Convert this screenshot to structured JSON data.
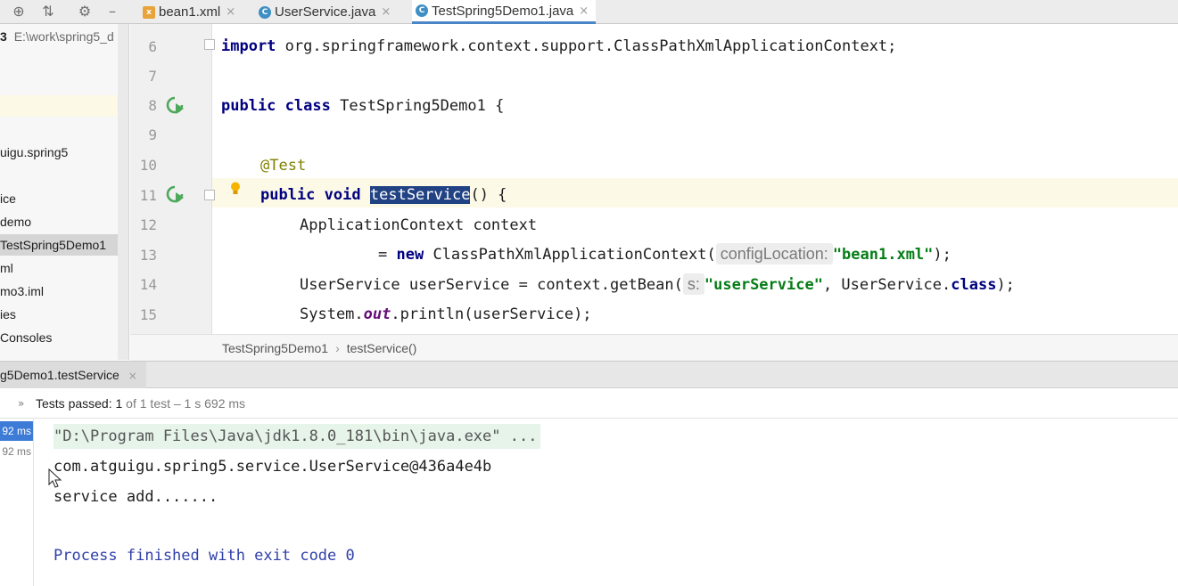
{
  "tabs": [
    {
      "label": "bean1.xml",
      "icon": "xml-file-icon"
    },
    {
      "label": "UserService.java",
      "icon": "class-file-icon"
    },
    {
      "label": "TestSpring5Demo1.java",
      "icon": "class-file-icon"
    }
  ],
  "sidebar": {
    "project_label": "3",
    "project_path": "E:\\work\\spring5_d",
    "items": [
      "uigu.spring5",
      "ice",
      "demo",
      "TestSpring5Demo1",
      "ml",
      "mo3.iml",
      "ies",
      "Consoles"
    ]
  },
  "editor": {
    "line_numbers": [
      "6",
      "7",
      "8",
      "9",
      "10",
      "11",
      "12",
      "13",
      "14",
      "15"
    ],
    "line6_kw": "import",
    "line6_rest": " org.springframework.context.support.ClassPathXmlApplicationContext;",
    "line8_kw1": "public",
    "line8_kw2": "class",
    "line8_rest": " TestSpring5Demo1 {",
    "line10_ann": "@Test",
    "line11_kw1": "public",
    "line11_kw2": "void",
    "line11_sel": "testService",
    "line11_rest": "() {",
    "line12": "ApplicationContext context",
    "line13_pre": "= ",
    "line13_kw": "new",
    "line13_mid": " ClassPathXmlApplicationContext(",
    "line13_hint": "configLocation:",
    "line13_str": "\"bean1.xml\"",
    "line13_end": ");",
    "line14_pre": "UserService userService = context.getBean(",
    "line14_hint": "s:",
    "line14_str": "\"userService\"",
    "line14_mid": ", UserService.",
    "line14_kw": "class",
    "line14_end": ");",
    "line15_pre": "System.",
    "line15_field": "out",
    "line15_rest": ".println(userService);"
  },
  "breadcrumb": [
    "TestSpring5Demo1",
    "testService()"
  ],
  "run": {
    "tab_label": "g5Demo1.testService",
    "status_prefix": "Tests passed: ",
    "status_count": "1",
    "status_rest": " of 1 test – 1 s 692 ms",
    "tree_times": [
      "92 ms",
      "92 ms"
    ],
    "console_lines": [
      "\"D:\\Program Files\\Java\\jdk1.8.0_181\\bin\\java.exe\" ...",
      "com.atguigu.spring5.service.UserService@436a4e4b",
      "service add.......",
      "",
      "Process finished with exit code 0"
    ]
  },
  "colors": {
    "keyword": "#000080",
    "string": "#067d17",
    "selection": "#214283",
    "run_green": "#4ca85a",
    "process_finished": "#2f3fa8"
  }
}
